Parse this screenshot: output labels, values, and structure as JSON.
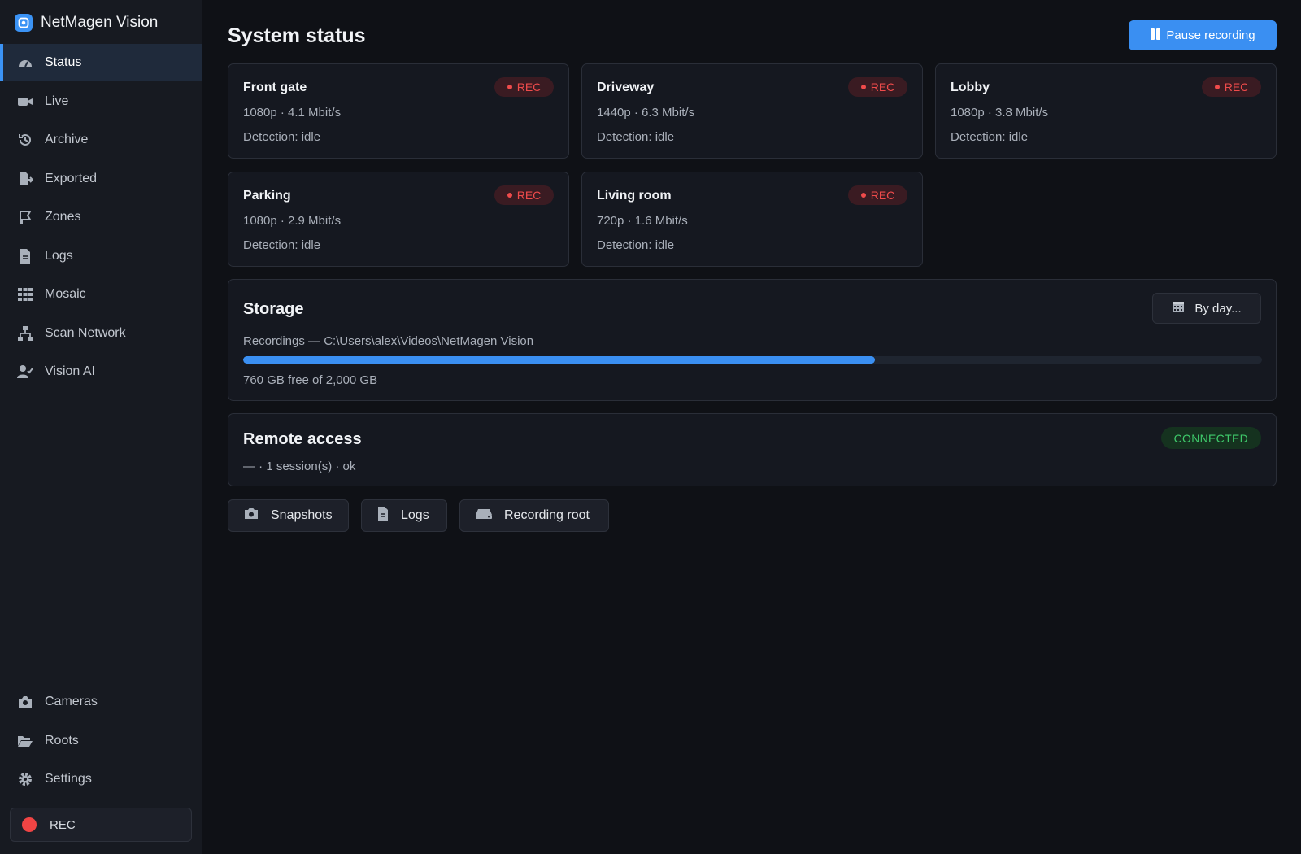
{
  "app": {
    "title": "NetMagen Vision"
  },
  "sidebar": {
    "items": [
      {
        "label": "Status",
        "icon": "gauge-icon",
        "active": true
      },
      {
        "label": "Live",
        "icon": "video-camera-icon"
      },
      {
        "label": "Archive",
        "icon": "history-icon"
      },
      {
        "label": "Exported",
        "icon": "file-export-icon"
      },
      {
        "label": "Zones",
        "icon": "zone-flag-icon"
      },
      {
        "label": "Logs",
        "icon": "document-icon"
      },
      {
        "label": "Mosaic",
        "icon": "grid-icon"
      },
      {
        "label": "Scan Network",
        "icon": "network-icon"
      },
      {
        "label": "Vision AI",
        "icon": "user-check-icon"
      }
    ],
    "bottom_items": [
      {
        "label": "Cameras",
        "icon": "camera-icon"
      },
      {
        "label": "Roots",
        "icon": "folder-open-icon"
      },
      {
        "label": "Settings",
        "icon": "gear-icon"
      }
    ],
    "rec_label": "REC"
  },
  "main": {
    "title": "System status",
    "pause_label": "Pause recording",
    "cameras": [
      {
        "name": "Front gate",
        "spec": "1080p · 4.1 Mbit/s",
        "detection": "Detection: idle",
        "badge": "REC"
      },
      {
        "name": "Driveway",
        "spec": "1440p · 6.3 Mbit/s",
        "detection": "Detection: idle",
        "badge": "REC"
      },
      {
        "name": "Lobby",
        "spec": "1080p · 3.8 Mbit/s",
        "detection": "Detection: idle",
        "badge": "REC"
      },
      {
        "name": "Parking",
        "spec": "1080p · 2.9 Mbit/s",
        "detection": "Detection: idle",
        "badge": "REC"
      },
      {
        "name": "Living room",
        "spec": "720p · 1.6 Mbit/s",
        "detection": "Detection: idle",
        "badge": "REC"
      }
    ],
    "storage": {
      "title": "Storage",
      "by_day_label": "By day...",
      "path": "Recordings — C:\\Users\\alex\\Videos\\NetMagen Vision",
      "used_fraction": 0.62,
      "free_text": "760 GB free of 2,000 GB"
    },
    "remote": {
      "title": "Remote access",
      "subtitle": "— · 1 session(s) · ok",
      "status": "CONNECTED"
    },
    "actions": [
      {
        "label": "Snapshots",
        "icon": "camera-icon"
      },
      {
        "label": "Logs",
        "icon": "document-icon"
      },
      {
        "label": "Recording root",
        "icon": "hard-drive-icon"
      }
    ]
  },
  "colors": {
    "accent": "#3a8ff2",
    "rec_red": "#ef4b4b",
    "connected_green": "#3fca6b",
    "background": "#0f1116",
    "sidebar": "#171a21"
  }
}
